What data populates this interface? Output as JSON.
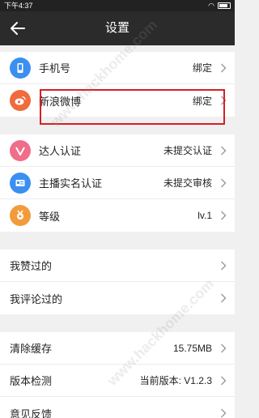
{
  "status_bar": {
    "time": "下午4:37"
  },
  "header": {
    "title": "设置"
  },
  "group1": [
    {
      "label": "手机号",
      "value": "绑定",
      "color": "#3b8ff0"
    },
    {
      "label": "新浪微博",
      "value": "绑定",
      "color": "#ef6b3d"
    }
  ],
  "group2": [
    {
      "label": "达人认证",
      "value": "未提交认证",
      "color": "#ef6e8a"
    },
    {
      "label": "主播实名认证",
      "value": "未提交审核",
      "color": "#3b8ff0"
    },
    {
      "label": "等级",
      "value": "lv.1",
      "color": "#f39b3b"
    }
  ],
  "group3": [
    {
      "label": "我赞过的"
    },
    {
      "label": "我评论过的"
    }
  ],
  "group4": [
    {
      "label": "清除缓存",
      "value": "15.75MB"
    },
    {
      "label": "版本检测",
      "value": "当前版本: V1.2.3"
    },
    {
      "label": "意见反馈"
    }
  ],
  "watermark": "www.hackhome.com"
}
